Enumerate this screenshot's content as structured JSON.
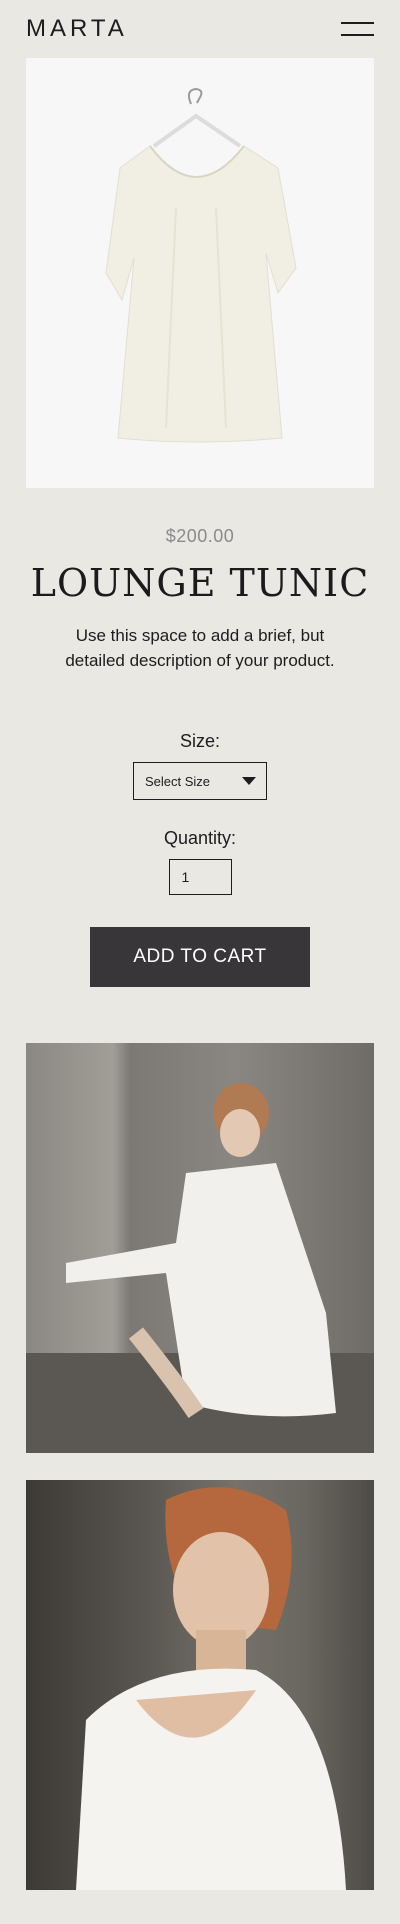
{
  "header": {
    "logo": "MARTA"
  },
  "product": {
    "price": "$200.00",
    "title": "LOUNGE TUNIC",
    "description": "Use this space to add a brief, but detailed description of your product."
  },
  "form": {
    "size_label": "Size:",
    "size_selected": "Select Size",
    "quantity_label": "Quantity:",
    "quantity_value": "1",
    "add_to_cart_label": "ADD TO CART"
  }
}
